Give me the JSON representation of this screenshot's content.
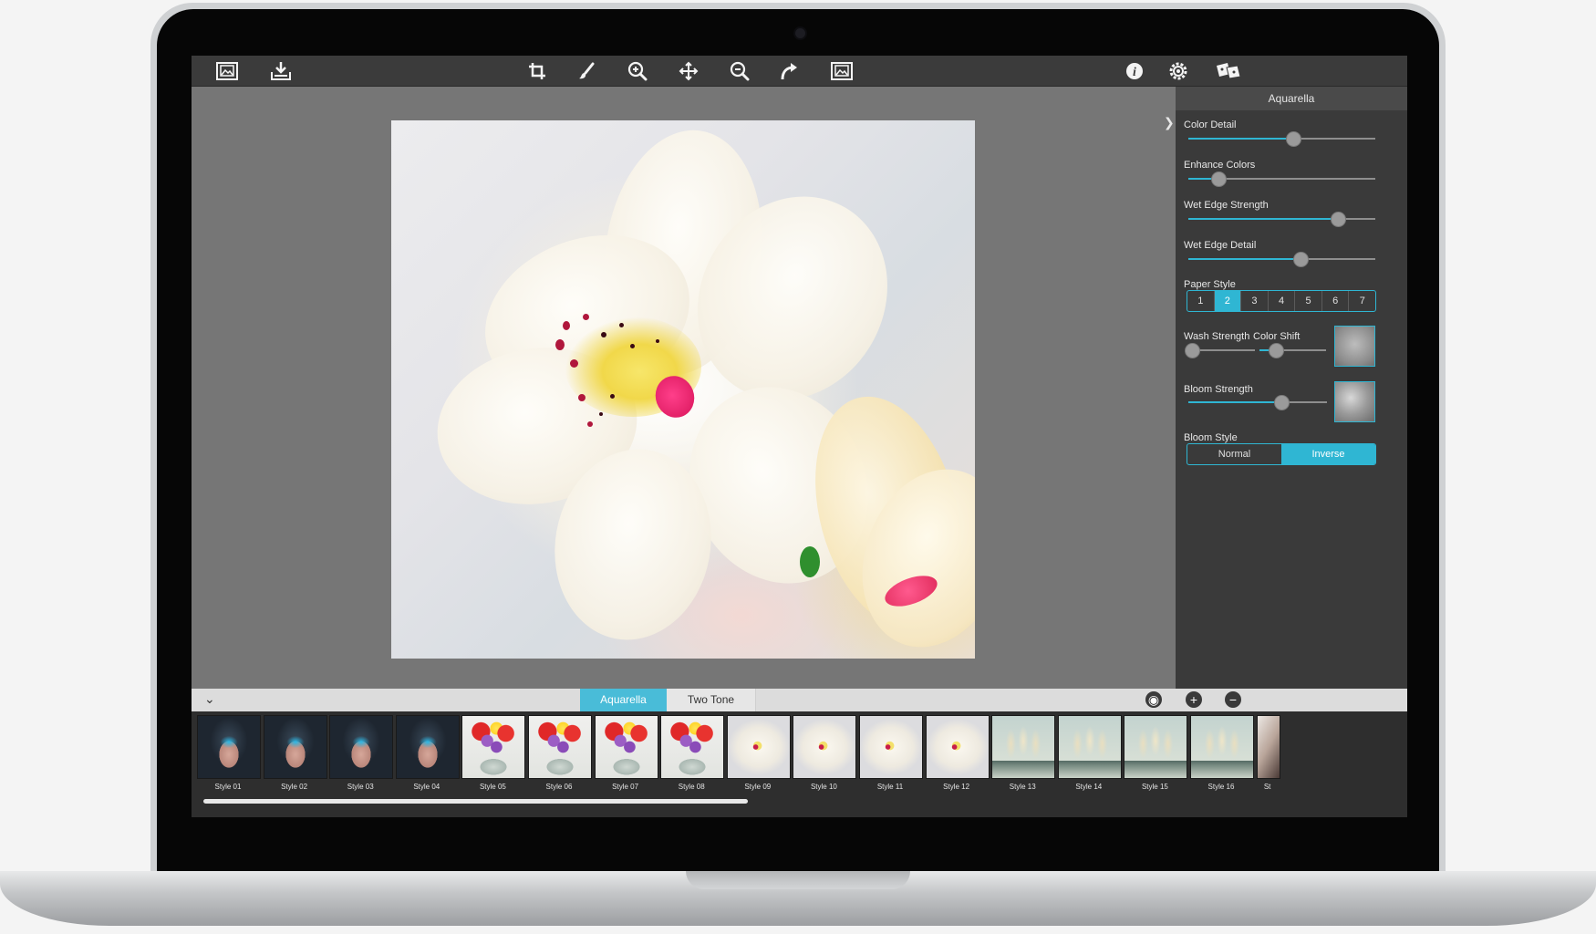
{
  "toolbar": {
    "left_icons": [
      "image-icon",
      "save-icon"
    ],
    "center_icons": [
      "crop-icon",
      "brush-icon",
      "zoom-in-icon",
      "pan-icon",
      "zoom-out-icon",
      "redo-icon",
      "fit-image-icon"
    ],
    "right_icons": [
      "info-icon",
      "settings-icon",
      "share-icon"
    ]
  },
  "panel": {
    "title": "Aquarella",
    "sliders": [
      {
        "label": "Color Detail",
        "value": 0.56
      },
      {
        "label": "Enhance Colors",
        "value": 0.16
      },
      {
        "label": "Wet Edge Strength",
        "value": 0.8
      },
      {
        "label": "Wet Edge Detail",
        "value": 0.6
      }
    ],
    "paper_style": {
      "label": "Paper Style",
      "options": [
        "1",
        "2",
        "3",
        "4",
        "5",
        "6",
        "7"
      ],
      "selected": "2"
    },
    "wash_strength": {
      "label": "Wash Strength",
      "value": 0.05
    },
    "color_shift": {
      "label": "Color Shift",
      "value": 0.25
    },
    "bloom_strength": {
      "label": "Bloom Strength",
      "value": 0.67
    },
    "bloom_style": {
      "label": "Bloom Style",
      "options": [
        "Normal",
        "Inverse"
      ],
      "selected": "Inverse"
    }
  },
  "tabs": [
    {
      "label": "Aquarella",
      "active": true
    },
    {
      "label": "Two Tone",
      "active": false
    }
  ],
  "styles": [
    {
      "name": "Style 01",
      "kind": "girl"
    },
    {
      "name": "Style 02",
      "kind": "girl"
    },
    {
      "name": "Style 03",
      "kind": "girl"
    },
    {
      "name": "Style 04",
      "kind": "girl"
    },
    {
      "name": "Style 05",
      "kind": "flower"
    },
    {
      "name": "Style 06",
      "kind": "flower"
    },
    {
      "name": "Style 07",
      "kind": "flower"
    },
    {
      "name": "Style 08",
      "kind": "flower"
    },
    {
      "name": "Style 09",
      "kind": "orchid"
    },
    {
      "name": "Style 10",
      "kind": "orchid"
    },
    {
      "name": "Style 11",
      "kind": "orchid"
    },
    {
      "name": "Style 12",
      "kind": "orchid"
    },
    {
      "name": "Style 13",
      "kind": "ship"
    },
    {
      "name": "Style 14",
      "kind": "ship"
    },
    {
      "name": "Style 15",
      "kind": "ship"
    },
    {
      "name": "Style 16",
      "kind": "ship"
    },
    {
      "name": "St",
      "kind": "last"
    }
  ],
  "colors": {
    "accent": "#2fb6d3"
  }
}
